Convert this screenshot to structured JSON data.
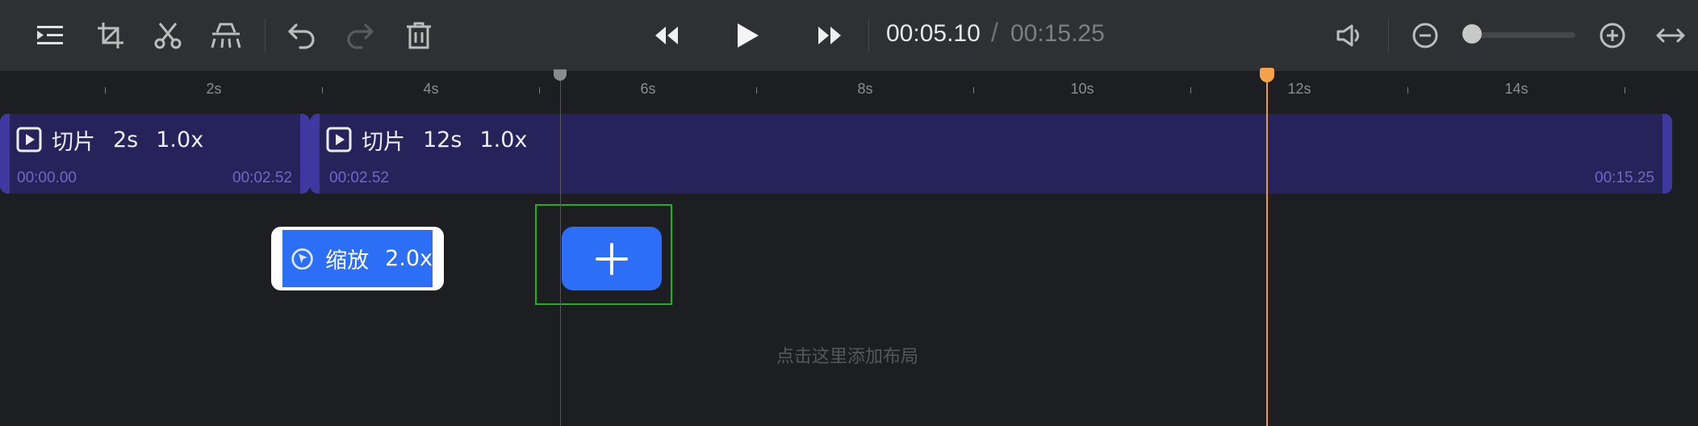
{
  "toolbar": {
    "left_icons": [
      "split-list-icon",
      "crop-icon",
      "scissors-icon",
      "perspective-icon",
      "undo-icon",
      "redo-icon",
      "trash-icon"
    ],
    "transport_icons": [
      "rewind-icon",
      "play-icon",
      "fast-forward-icon"
    ],
    "current_time": "00:05.10",
    "separator": "/",
    "total_time": "00:15.25",
    "right_icons": [
      "volume-icon",
      "zoom-out-icon",
      "zoom-in-icon",
      "fit-width-icon"
    ],
    "zoom_level": 0.0
  },
  "ruler": {
    "labels": [
      "2s",
      "4s",
      "6s",
      "8s",
      "10s",
      "12s",
      "14s"
    ]
  },
  "tracks": {
    "clips": [
      {
        "name": "切片",
        "duration": "2s",
        "speed": "1.0x",
        "start": "00:00.00",
        "end": "00:02.52"
      },
      {
        "name": "切片",
        "duration": "12s",
        "speed": "1.0x",
        "start": "00:02.52",
        "end": "00:15.25"
      }
    ],
    "zoom_clip": {
      "name": "缩放",
      "value": "2.0x"
    },
    "add_button_icon": "plus-icon",
    "hint": "点击这里添加布局"
  },
  "colors": {
    "toolbar_bg": "#2f3033",
    "timeline_bg": "#1d1e22",
    "clip_bg": "#26235a",
    "clip_handle": "#3f38a0",
    "accent_blue": "#2d6ef6",
    "playhead": "#f29a3a",
    "selection_outline": "#1fb21f"
  }
}
